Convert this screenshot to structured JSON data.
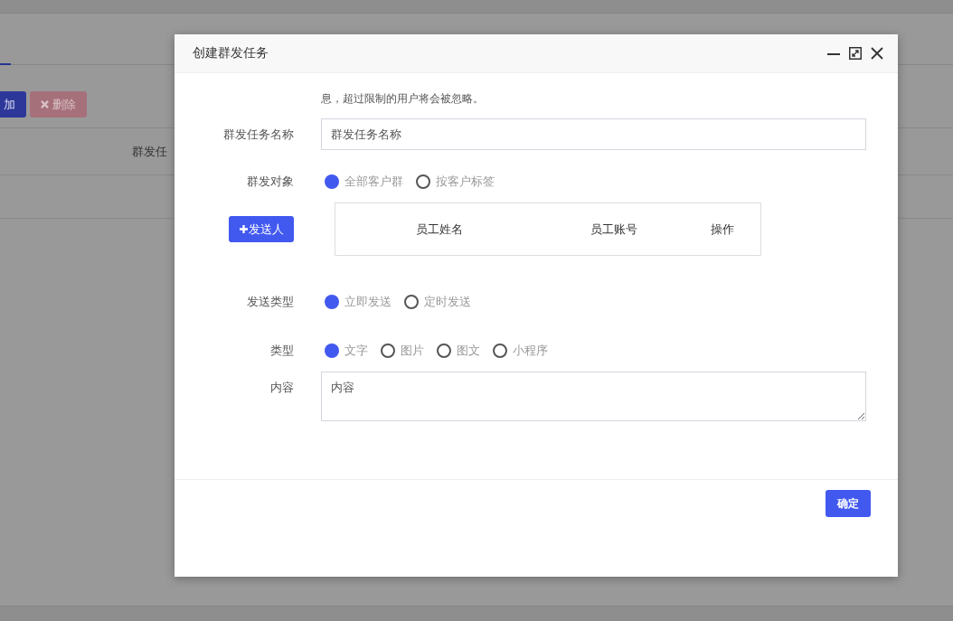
{
  "background": {
    "add_button": "加",
    "delete_button": "删除",
    "table_header": "群发任"
  },
  "dialog": {
    "title": "创建群发任务",
    "note": "息，超过限制的用户将会被忽略。",
    "name_field": {
      "label": "群发任务名称",
      "placeholder": "群发任务名称"
    },
    "target": {
      "label": "群发对象",
      "options": [
        {
          "label": "全部客户群",
          "selected": true
        },
        {
          "label": "按客户标签",
          "selected": false
        }
      ]
    },
    "senders": {
      "button": "发送人",
      "columns": [
        "员工姓名",
        "员工账号",
        "操作"
      ]
    },
    "send_type": {
      "label": "发送类型",
      "options": [
        {
          "label": "立即发送",
          "selected": true
        },
        {
          "label": "定时发送",
          "selected": false
        }
      ]
    },
    "type": {
      "label": "类型",
      "options": [
        {
          "label": "文字",
          "selected": true
        },
        {
          "label": "图片",
          "selected": false
        },
        {
          "label": "图文",
          "selected": false
        },
        {
          "label": "小程序",
          "selected": false
        }
      ]
    },
    "content": {
      "label": "内容",
      "placeholder": "内容"
    },
    "confirm_button": "确定"
  }
}
